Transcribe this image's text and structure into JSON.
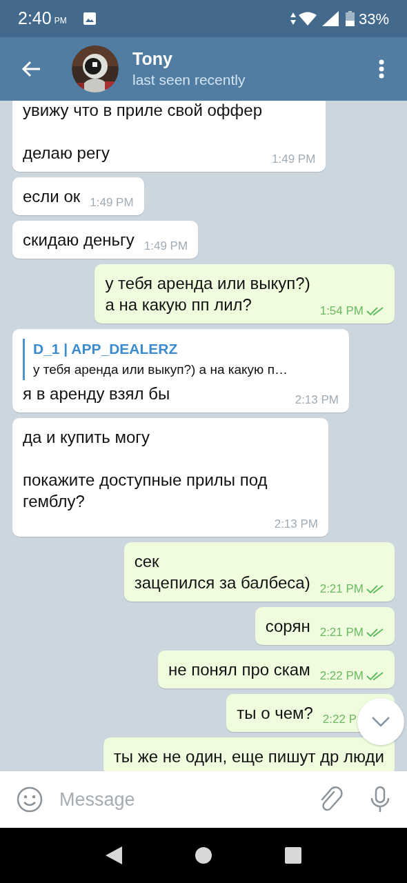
{
  "status_bar": {
    "time": "2:40",
    "ampm": "PM",
    "battery": "33%"
  },
  "header": {
    "name": "Tony",
    "status": "last seen recently"
  },
  "messages": [
    {
      "kind": "incoming",
      "text": "увижу что в приле свой оффер\n\nделаю регу",
      "time": "1:49 PM"
    },
    {
      "kind": "incoming",
      "text": "если ок",
      "time": "1:49 PM"
    },
    {
      "kind": "incoming",
      "text": "скидаю деньгу",
      "time": "1:49 PM"
    },
    {
      "kind": "outgoing",
      "text": "у тебя аренда или выкуп?)\nа на какую пп лил?",
      "time": "1:54 PM",
      "read": true
    },
    {
      "kind": "incoming",
      "reply": {
        "author": "D_1 | APP_DEALERZ",
        "text": "у тебя аренда или выкуп?) а на какую п…"
      },
      "text": "я в аренду взял бы",
      "time": "2:13 PM"
    },
    {
      "kind": "incoming",
      "text": "да и купить могу\n\nпокажите доступные прилы под гемблу?",
      "time": "2:13 PM"
    },
    {
      "kind": "outgoing",
      "text": "сек\nзацепился за балбеса)",
      "time": "2:21 PM",
      "read": true
    },
    {
      "kind": "outgoing",
      "text": "сорян",
      "time": "2:21 PM",
      "read": true
    },
    {
      "kind": "outgoing",
      "text": "не понял про скам",
      "time": "2:22 PM",
      "read": true
    },
    {
      "kind": "outgoing",
      "text": "ты о чем?",
      "time": "2:22 P"
    },
    {
      "kind": "outgoing",
      "text": "ты же не один, еще пишут др люди"
    }
  ],
  "composer": {
    "placeholder": "Message"
  }
}
